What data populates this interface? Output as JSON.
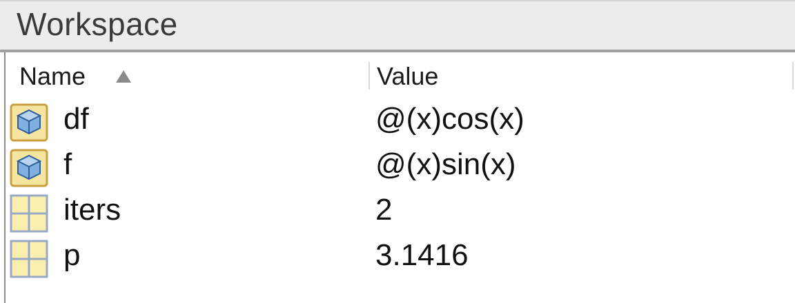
{
  "panel": {
    "title": "Workspace"
  },
  "table": {
    "columns": {
      "name": "Name",
      "value": "Value"
    },
    "sort": "ascending",
    "rows": [
      {
        "name": "df",
        "value": "@(x)cos(x)",
        "icon": "function-handle-icon"
      },
      {
        "name": "f",
        "value": "@(x)sin(x)",
        "icon": "function-handle-icon"
      },
      {
        "name": "iters",
        "value": "2",
        "icon": "numeric-array-icon"
      },
      {
        "name": "p",
        "value": "3.1416",
        "icon": "numeric-array-icon"
      }
    ]
  },
  "colors": {
    "titlebar": "#ececec",
    "icon_fill": "#f4e6a0",
    "icon_border": "#c8a040",
    "cube": "#4a86c8"
  }
}
